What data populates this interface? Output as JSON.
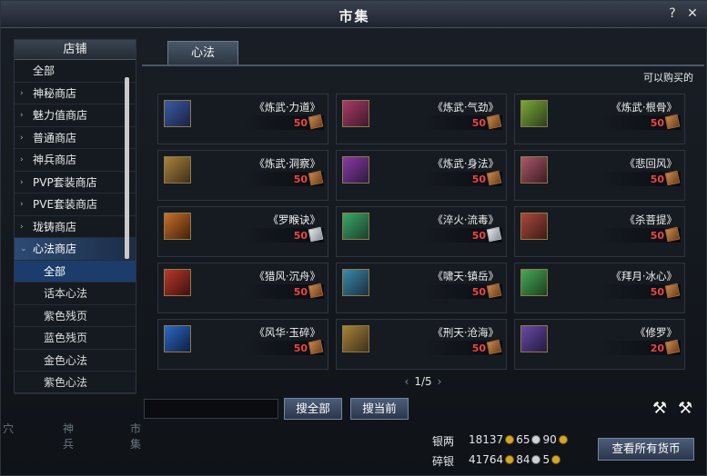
{
  "window": {
    "title": "市集",
    "help": "?",
    "close": "✕"
  },
  "sidebar": {
    "header": "店铺",
    "items": [
      {
        "label": "全部",
        "arrow": ""
      },
      {
        "label": "神秘商店",
        "arrow": "›"
      },
      {
        "label": "魅力值商店",
        "arrow": "›"
      },
      {
        "label": "普通商店",
        "arrow": "›"
      },
      {
        "label": "神兵商店",
        "arrow": "›"
      },
      {
        "label": "PVP套装商店",
        "arrow": "›"
      },
      {
        "label": "PVE套装商店",
        "arrow": "›"
      },
      {
        "label": "珑铸商店",
        "arrow": "›"
      },
      {
        "label": "心法商店",
        "arrow": "⌄"
      }
    ],
    "subitems": [
      "全部",
      "话本心法",
      "紫色残页",
      "蓝色残页",
      "金色心法",
      "紫色心法"
    ]
  },
  "tab": {
    "label": "心法"
  },
  "buyable_label": "可以购买的",
  "items": [
    {
      "name": "《炼武·力道》",
      "price": "50",
      "currency": "copper"
    },
    {
      "name": "《炼武·气劲》",
      "price": "50",
      "currency": "copper"
    },
    {
      "name": "《炼武·根骨》",
      "price": "50",
      "currency": "copper"
    },
    {
      "name": "《炼武·洞察》",
      "price": "50",
      "currency": "copper"
    },
    {
      "name": "《炼武·身法》",
      "price": "50",
      "currency": "copper"
    },
    {
      "name": "《悲回风》",
      "price": "50",
      "currency": "copper"
    },
    {
      "name": "《罗睺诀》",
      "price": "50",
      "currency": "silver"
    },
    {
      "name": "《淬火·流毒》",
      "price": "50",
      "currency": "silver"
    },
    {
      "name": "《杀菩提》",
      "price": "50",
      "currency": "copper"
    },
    {
      "name": "《猎风·沉舟》",
      "price": "50",
      "currency": "copper"
    },
    {
      "name": "《啸天·镇岳》",
      "price": "50",
      "currency": "copper"
    },
    {
      "name": "《拜月·冰心》",
      "price": "50",
      "currency": "copper"
    },
    {
      "name": "《风华·玉碎》",
      "price": "50",
      "currency": "copper"
    },
    {
      "name": "《刑天·沧海》",
      "price": "50",
      "currency": "copper"
    },
    {
      "name": "《修罗》",
      "price": "20",
      "currency": "copper"
    }
  ],
  "pager": {
    "text": "1/5",
    "prev": "‹",
    "next": "›"
  },
  "buttons": {
    "search_all": "搜全部",
    "search_current": "搜当前",
    "view_currency": "查看所有货币"
  },
  "currency": {
    "silver_label": "银两",
    "silver_value": "18137",
    "silver_a": "65",
    "silver_b": "90",
    "scrap_label": "碎银",
    "scrap_value": "41764",
    "scrap_a": "84",
    "scrap_b": "5"
  },
  "background_tabs": [
    "穴",
    "神兵",
    "市集"
  ],
  "colors": {
    "price": "#e94545",
    "accent": "#2c4a73"
  }
}
